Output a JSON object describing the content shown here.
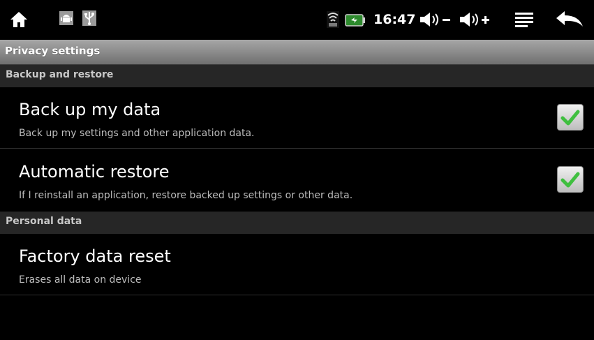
{
  "status_bar": {
    "clock": "16:47",
    "icons": [
      "home-icon",
      "android-debug-icon",
      "usb-icon",
      "wifi-icon",
      "battery-icon",
      "volume-down-icon",
      "volume-up-icon",
      "menu-icon",
      "back-icon"
    ]
  },
  "title_bar": {
    "title": "Privacy settings"
  },
  "sections": [
    {
      "header": "Backup and restore",
      "items": [
        {
          "title": "Back up my data",
          "summary": "Back up my settings and other application data.",
          "checked": true
        },
        {
          "title": "Automatic restore",
          "summary": "If I reinstall an application, restore backed up settings or other data.",
          "checked": true
        }
      ]
    },
    {
      "header": "Personal data",
      "items": [
        {
          "title": "Factory data reset",
          "summary": "Erases all data on device"
        }
      ]
    }
  ],
  "colors": {
    "check_green": "#3fbf3f",
    "category_bg": "#262626",
    "titlebar_bg": "#8e8e8e"
  }
}
